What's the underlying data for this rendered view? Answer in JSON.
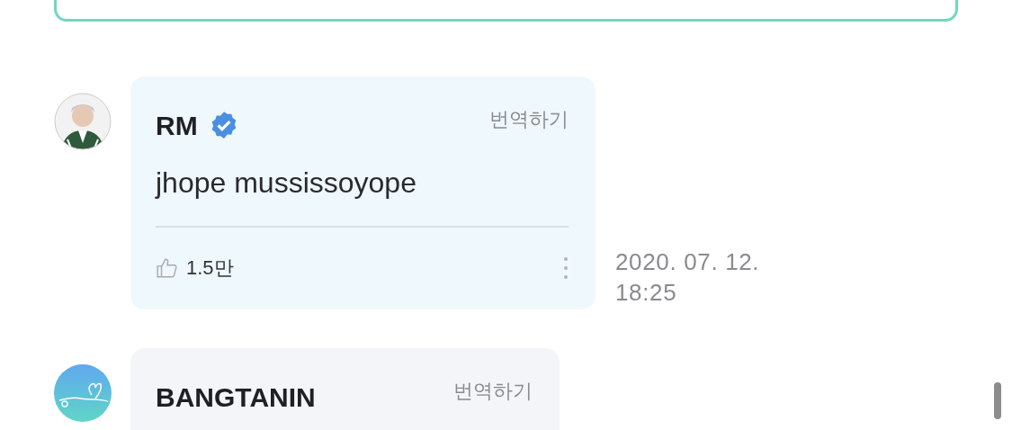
{
  "comments": [
    {
      "author": "RM",
      "verified": true,
      "translate": "번역하기",
      "text": "jhope mussissoyope",
      "likes": "1.5만",
      "time": "2020. 07. 12. 18:25"
    },
    {
      "avatar": {
        "kind": "logo"
      },
      "author": "BANGTANIN",
      "verified": false,
      "translate": "번역하기"
    }
  ]
}
